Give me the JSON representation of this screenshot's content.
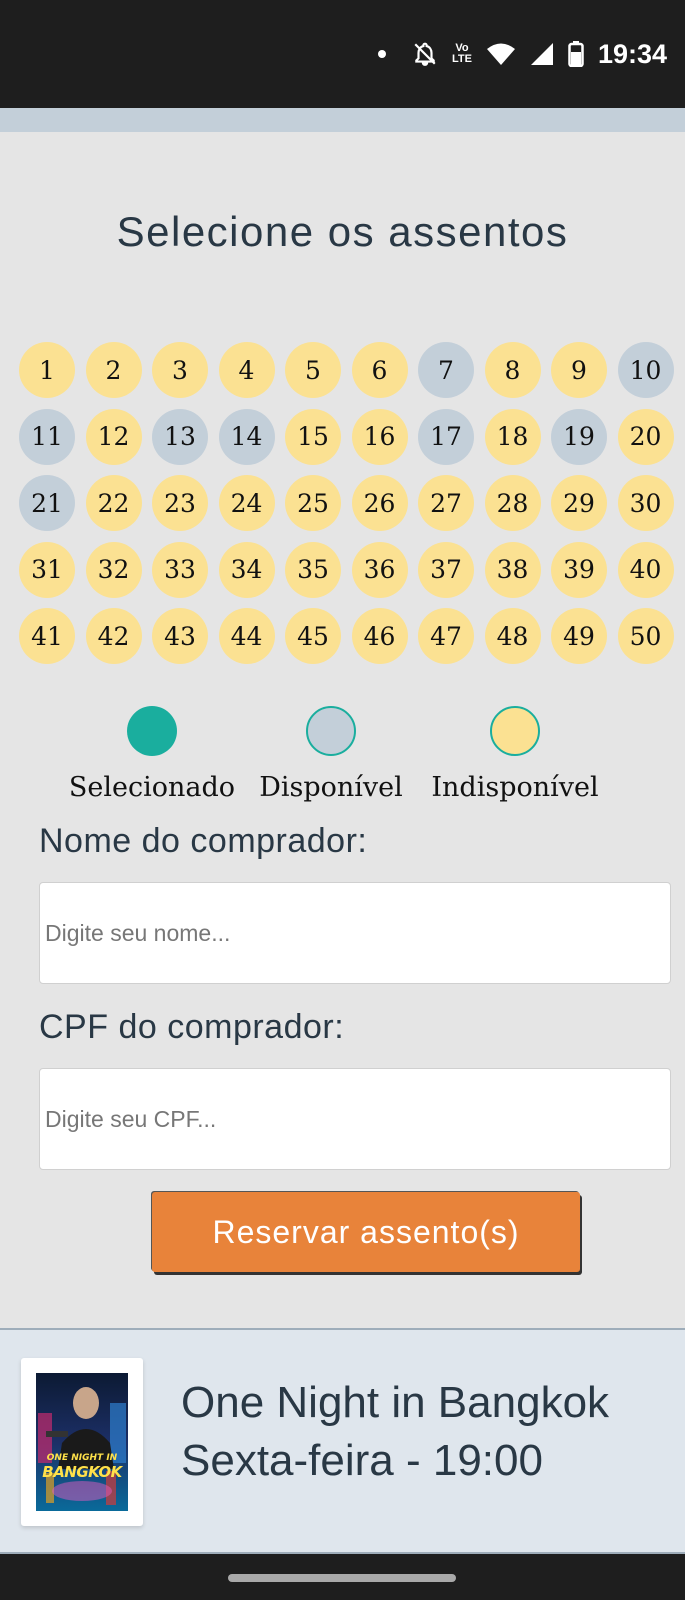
{
  "status_bar": {
    "time": "19:34",
    "icons": [
      "notification-dot-icon",
      "silent-bell-icon",
      "volte-icon",
      "wifi-icon",
      "signal-icon",
      "battery-icon"
    ],
    "volte_top": "Vo",
    "volte_bottom": "LTE"
  },
  "page": {
    "title": "Selecione os assentos"
  },
  "seats": [
    {
      "number": "1",
      "status": "unavailable"
    },
    {
      "number": "2",
      "status": "unavailable"
    },
    {
      "number": "3",
      "status": "unavailable"
    },
    {
      "number": "4",
      "status": "unavailable"
    },
    {
      "number": "5",
      "status": "unavailable"
    },
    {
      "number": "6",
      "status": "unavailable"
    },
    {
      "number": "7",
      "status": "available"
    },
    {
      "number": "8",
      "status": "unavailable"
    },
    {
      "number": "9",
      "status": "unavailable"
    },
    {
      "number": "10",
      "status": "available"
    },
    {
      "number": "11",
      "status": "available"
    },
    {
      "number": "12",
      "status": "unavailable"
    },
    {
      "number": "13",
      "status": "available"
    },
    {
      "number": "14",
      "status": "available"
    },
    {
      "number": "15",
      "status": "unavailable"
    },
    {
      "number": "16",
      "status": "unavailable"
    },
    {
      "number": "17",
      "status": "available"
    },
    {
      "number": "18",
      "status": "unavailable"
    },
    {
      "number": "19",
      "status": "available"
    },
    {
      "number": "20",
      "status": "unavailable"
    },
    {
      "number": "21",
      "status": "available"
    },
    {
      "number": "22",
      "status": "unavailable"
    },
    {
      "number": "23",
      "status": "unavailable"
    },
    {
      "number": "24",
      "status": "unavailable"
    },
    {
      "number": "25",
      "status": "unavailable"
    },
    {
      "number": "26",
      "status": "unavailable"
    },
    {
      "number": "27",
      "status": "unavailable"
    },
    {
      "number": "28",
      "status": "unavailable"
    },
    {
      "number": "29",
      "status": "unavailable"
    },
    {
      "number": "30",
      "status": "unavailable"
    },
    {
      "number": "31",
      "status": "unavailable"
    },
    {
      "number": "32",
      "status": "unavailable"
    },
    {
      "number": "33",
      "status": "unavailable"
    },
    {
      "number": "34",
      "status": "unavailable"
    },
    {
      "number": "35",
      "status": "unavailable"
    },
    {
      "number": "36",
      "status": "unavailable"
    },
    {
      "number": "37",
      "status": "unavailable"
    },
    {
      "number": "38",
      "status": "unavailable"
    },
    {
      "number": "39",
      "status": "unavailable"
    },
    {
      "number": "40",
      "status": "unavailable"
    },
    {
      "number": "41",
      "status": "unavailable"
    },
    {
      "number": "42",
      "status": "unavailable"
    },
    {
      "number": "43",
      "status": "unavailable"
    },
    {
      "number": "44",
      "status": "unavailable"
    },
    {
      "number": "45",
      "status": "unavailable"
    },
    {
      "number": "46",
      "status": "unavailable"
    },
    {
      "number": "47",
      "status": "unavailable"
    },
    {
      "number": "48",
      "status": "unavailable"
    },
    {
      "number": "49",
      "status": "unavailable"
    },
    {
      "number": "50",
      "status": "unavailable"
    }
  ],
  "legend": {
    "selected": {
      "label": "Selecionado",
      "color": "#1aae9e"
    },
    "available": {
      "label": "Disponível",
      "color": "#c3cfd9",
      "border": "#7b8b99"
    },
    "unavailable": {
      "label": "Indisponível",
      "color": "#fbe192",
      "border": "#f7c52b"
    }
  },
  "form": {
    "name_label": "Nome do comprador:",
    "name_placeholder": "Digite seu nome...",
    "name_value": "",
    "cpf_label": "CPF do comprador:",
    "cpf_placeholder": "Digite seu CPF...",
    "cpf_value": "",
    "submit_label": "Reservar assento(s)"
  },
  "footer": {
    "movie_title": "One Night in Bangkok",
    "session": "Sexta-feira - 19:00",
    "poster_title_line1": "ONE NIGHT IN",
    "poster_title_line2": "BANGKOK"
  },
  "colors": {
    "accent": "#e8833a",
    "text": "#293845",
    "seat_available": "#c3cfd9",
    "seat_unavailable": "#fbe192",
    "seat_selected": "#1aae9e"
  }
}
